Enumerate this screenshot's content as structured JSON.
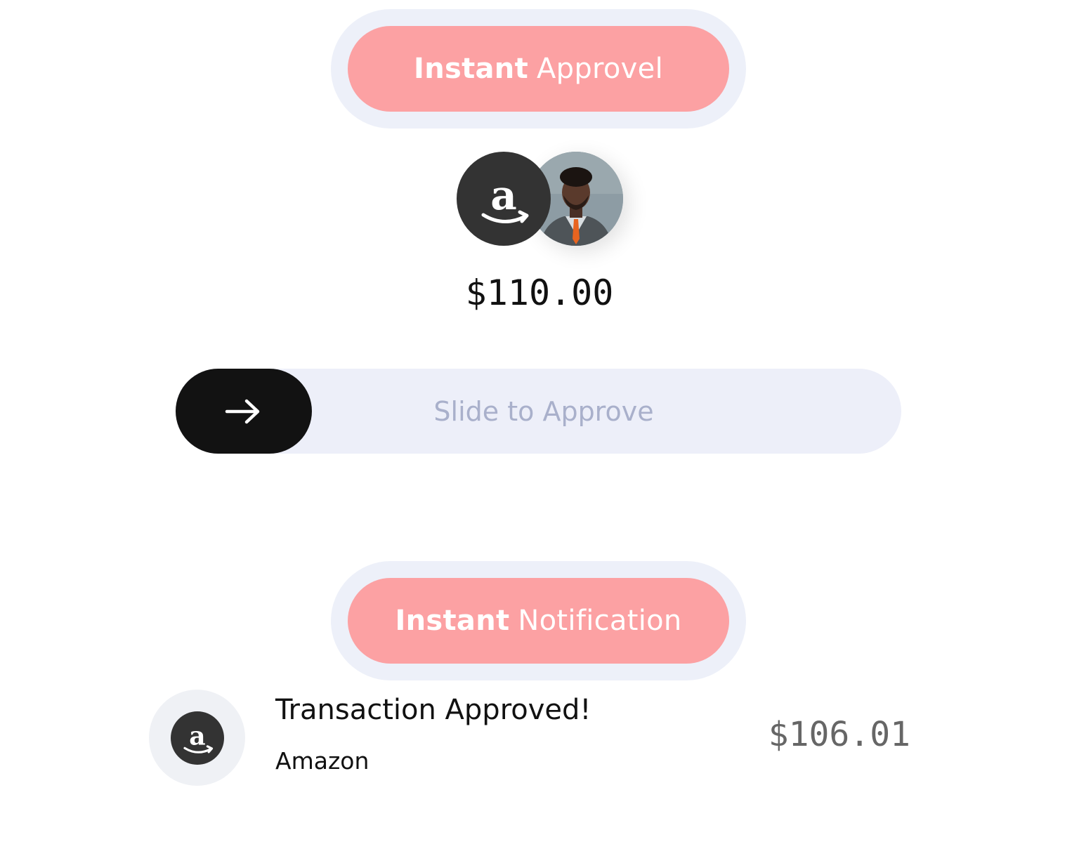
{
  "approval_badge": {
    "bold": "Instant",
    "light": "Approvel"
  },
  "avatars": {
    "merchant_icon": "amazon-logo-icon",
    "user_icon": "user-photo"
  },
  "payment": {
    "amount": "$110.00"
  },
  "slider": {
    "label": "Slide to Approve",
    "knob_icon": "arrow-right-icon",
    "progress": 0
  },
  "notification_badge": {
    "bold": "Instant",
    "light": "Notification"
  },
  "notification": {
    "icon": "amazon-logo-icon",
    "title": "Transaction Approved!",
    "merchant": "Amazon",
    "amount": "$106.01"
  },
  "colors": {
    "pill_bg": "#fca1a3",
    "pill_outline": "#edf0f9",
    "slider_track": "#edeff9",
    "slider_knob": "#121212",
    "slider_text": "#a9b0cb",
    "amazon_dark": "#333333"
  }
}
